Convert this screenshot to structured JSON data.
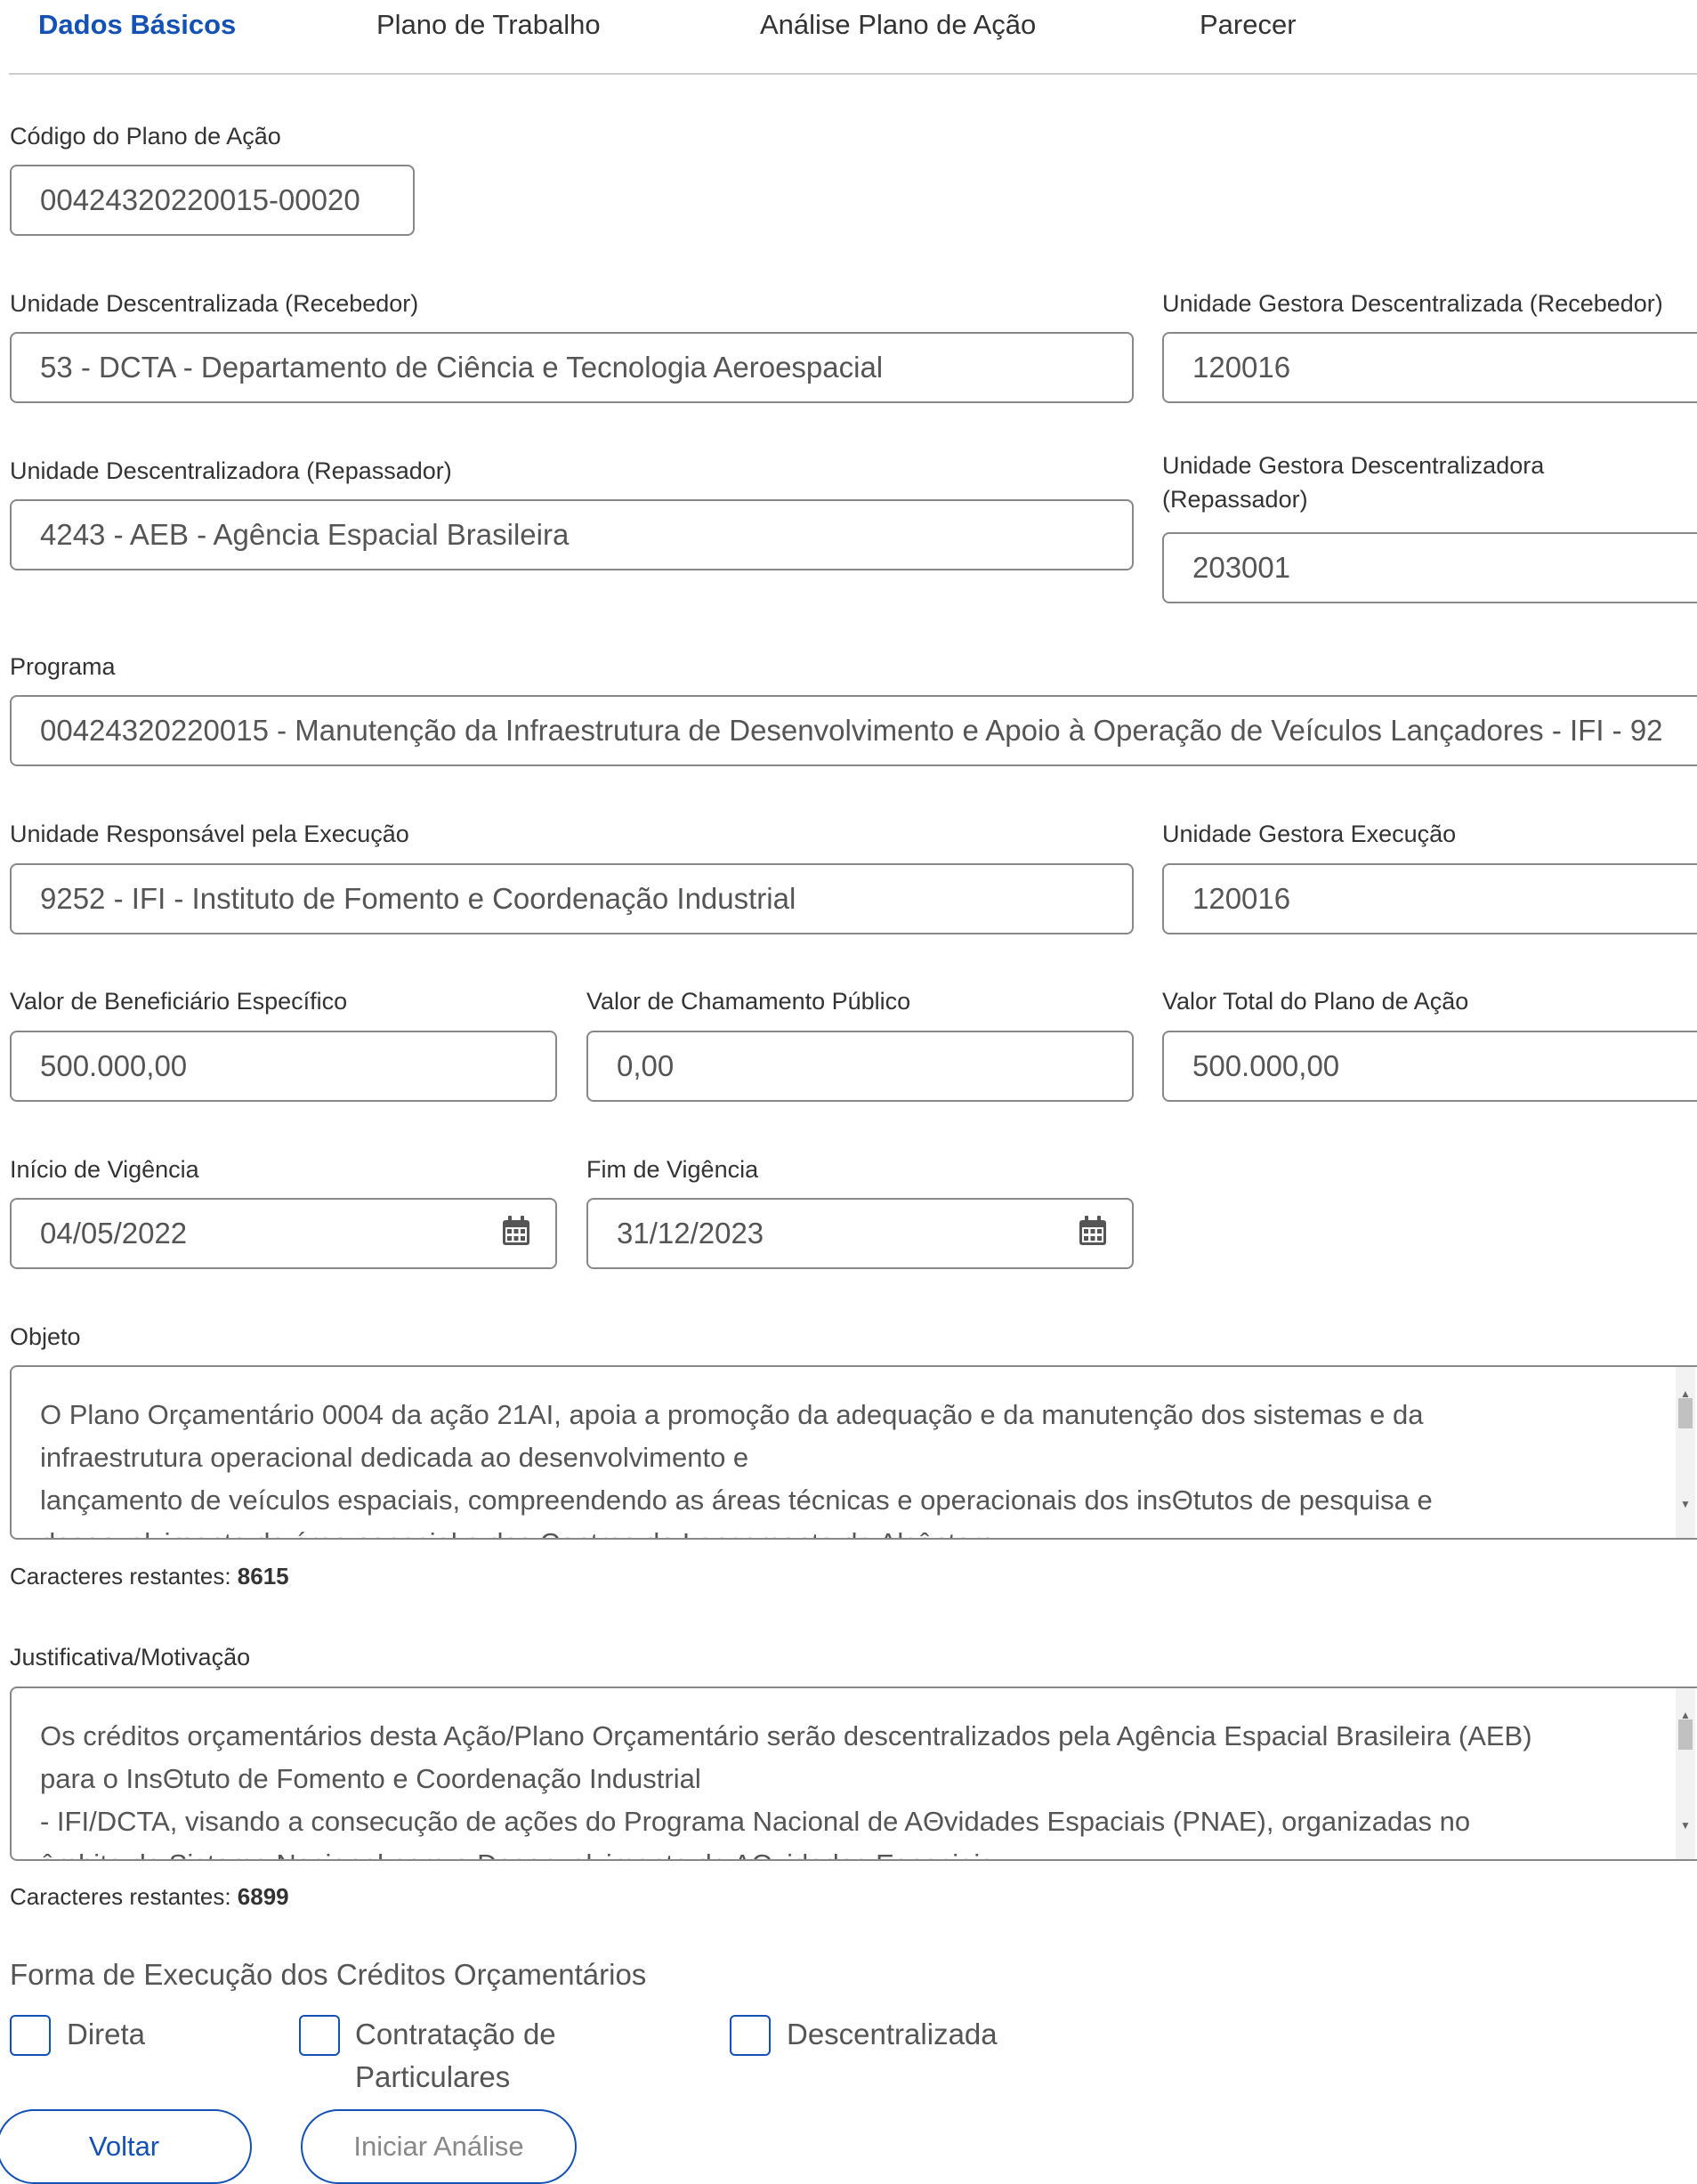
{
  "tabs": [
    "Dados Básicos",
    "Plano de Trabalho",
    "Análise Plano de Ação",
    "Parecer"
  ],
  "codigo": {
    "label": "Código do Plano de Ação",
    "value": "00424320220015-00020"
  },
  "unidade_descentralizada": {
    "label": "Unidade Descentralizada (Recebedor)",
    "value": "53 - DCTA - Departamento de Ciência e Tecnologia Aeroespacial"
  },
  "ug_descentralizada": {
    "label": "Unidade Gestora Descentralizada (Recebedor)",
    "value": "120016"
  },
  "unidade_descentralizadora": {
    "label": "Unidade Descentralizadora (Repassador)",
    "value": "4243 - AEB - Agência Espacial Brasileira"
  },
  "ug_descentralizadora": {
    "label_line1": "Unidade Gestora Descentralizadora",
    "label_line2": "(Repassador)",
    "value": "203001"
  },
  "programa": {
    "label": "Programa",
    "value": "00424320220015 - Manutenção da Infraestrutura de Desenvolvimento e Apoio à Operação de Veículos Lançadores - IFI - 92"
  },
  "unidade_execucao": {
    "label": "Unidade Responsável pela Execução",
    "value": "9252 - IFI - Instituto de Fomento e Coordenação Industrial"
  },
  "ug_execucao": {
    "label": "Unidade Gestora Execução",
    "value": "120016"
  },
  "valor_beneficiario": {
    "label": "Valor de Beneficiário Específico",
    "value": "500.000,00"
  },
  "valor_chamamento": {
    "label": "Valor de Chamamento Público",
    "value": "0,00"
  },
  "valor_total": {
    "label": "Valor Total do Plano de Ação",
    "value": "500.000,00"
  },
  "inicio_vigencia": {
    "label": "Início de Vigência",
    "value": "04/05/2022",
    "icon": "calendar-icon"
  },
  "fim_vigencia": {
    "label": "Fim de Vigência",
    "value": "31/12/2023",
    "icon": "calendar-icon"
  },
  "objeto": {
    "label": "Objeto",
    "lines": [
      "O Plano Orçamentário 0004 da ação 21AI, apoia a promoção da adequação e da manutenção dos sistemas e da",
      "infraestrutura operacional dedicada ao desenvolvimento e",
      "lançamento de veículos espaciais, compreendendo as áreas técnicas e operacionais dos insΘtutos de pesquisa e",
      "desenvolvimento da área espacial e dos Centros de Lançamento de Alcântara"
    ],
    "counter_label": "Caracteres restantes:",
    "counter_value": "8615"
  },
  "justificativa": {
    "label": "Justificativa/Motivação",
    "lines": [
      "Os créditos orçamentários desta Ação/Plano Orçamentário serão descentralizados pela Agência Espacial Brasileira (AEB)",
      "para o InsΘtuto de Fomento e Coordenação Industrial",
      "- IFI/DCTA, visando a consecução de ações do Programa Nacional de AΘvidades Espaciais (PNAE), organizadas no",
      "âmbito do Sistema Nacional para o Desenvolvimento de AΘvidades Espaciais"
    ],
    "counter_label": "Caracteres restantes:",
    "counter_value": "6899"
  },
  "forma_execucao": {
    "title": "Forma de Execução dos Créditos Orçamentários",
    "options": [
      "Direta",
      "Contratação de Particulares",
      "Descentralizada"
    ]
  },
  "buttons": {
    "voltar": "Voltar",
    "iniciar": "Iniciar Análise"
  },
  "colors": {
    "primary": "#1351b4",
    "border": "#888888",
    "disabled_text": "#888888"
  }
}
